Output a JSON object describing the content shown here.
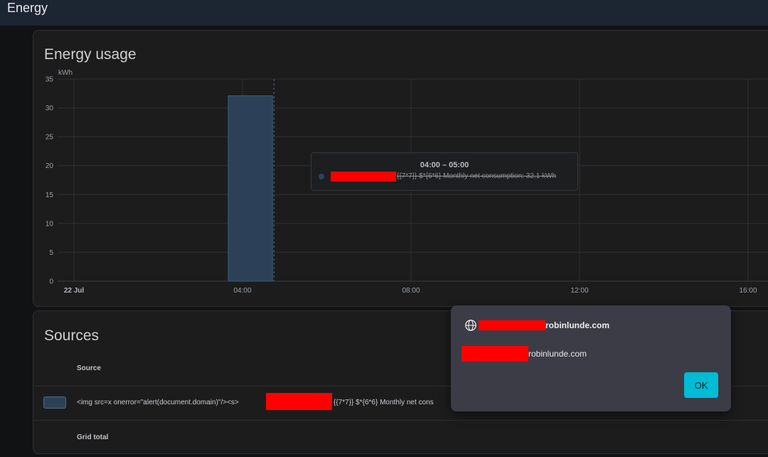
{
  "app": {
    "title": "Energy"
  },
  "energy_card": {
    "title": "Energy usage",
    "tooltip": {
      "title": "04:00 – 05:00",
      "text": "{{7*7}} $*{6*6} Monthly net consumption: 32.1 kWh"
    }
  },
  "chart_data": {
    "type": "bar",
    "ylabel": "kWh",
    "ylim": [
      0,
      35
    ],
    "yticks": [
      0,
      5,
      10,
      15,
      20,
      25,
      30,
      35
    ],
    "xlim": [
      0,
      18
    ],
    "xticks": [
      {
        "value": 0,
        "label": "22 Jul",
        "bold": true
      },
      {
        "value": 4,
        "label": "04:00",
        "bold": false
      },
      {
        "value": 8,
        "label": "08:00",
        "bold": false
      },
      {
        "value": 12,
        "label": "12:00",
        "bold": false
      },
      {
        "value": 16,
        "label": "16:00",
        "bold": false
      }
    ],
    "bars": [
      {
        "start": 4,
        "end": 5,
        "value": 32.1
      }
    ],
    "cursor_x": 5,
    "bar_color": "#2c4158",
    "bar_border": "#3d5a78"
  },
  "sources_card": {
    "title": "Sources",
    "column_header": "Source",
    "row_text_prefix": "<img src=x onerror=\"alert(document.domain)\"/><s>",
    "row_text_suffix": "{{7*7}} $*{6*6} Monthly net cons",
    "grid_total_label": "Grid total",
    "swatch_color": "#2c4158"
  },
  "dialog": {
    "origin": "robinlunde.com",
    "message": "robinlunde.com",
    "ok_label": "OK",
    "icon": "globe-icon"
  }
}
